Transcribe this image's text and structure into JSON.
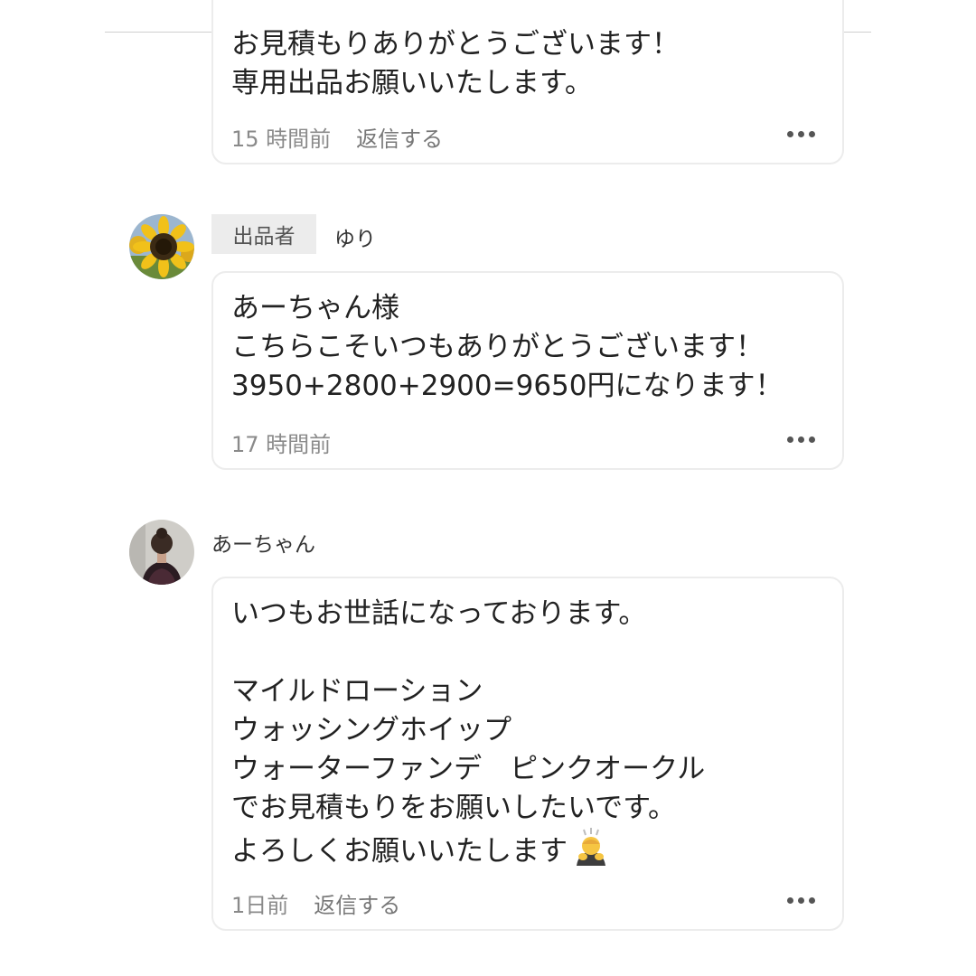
{
  "comments": [
    {
      "body": [
        "お見積もりありがとうございます！",
        "専用出品お願いいたします。"
      ],
      "time": "15 時間前",
      "reply_label": "返信する"
    },
    {
      "badge": "出品者",
      "user": "ゆり",
      "avatar_icon": "sunflower-icon",
      "body": [
        "あーちゃん様",
        "こちらこそいつもありがとうございます！",
        "3950+2800+2900=9650円になります！"
      ],
      "time": "17 時間前"
    },
    {
      "user": "あーちゃん",
      "avatar_icon": "person-photo",
      "body": [
        "いつもお世話になっております。",
        "",
        "マイルドローション",
        "ウォッシングホイップ",
        "ウォーターファンデ　ピンクオークル",
        "でお見積もりをお願いしたいです。",
        "よろしくお願いいたします"
      ],
      "time": "1日前",
      "reply_label": "返信する"
    }
  ],
  "more_icon": "more-options-icon",
  "bow_emoji_icon": "person-bowing-emoji"
}
